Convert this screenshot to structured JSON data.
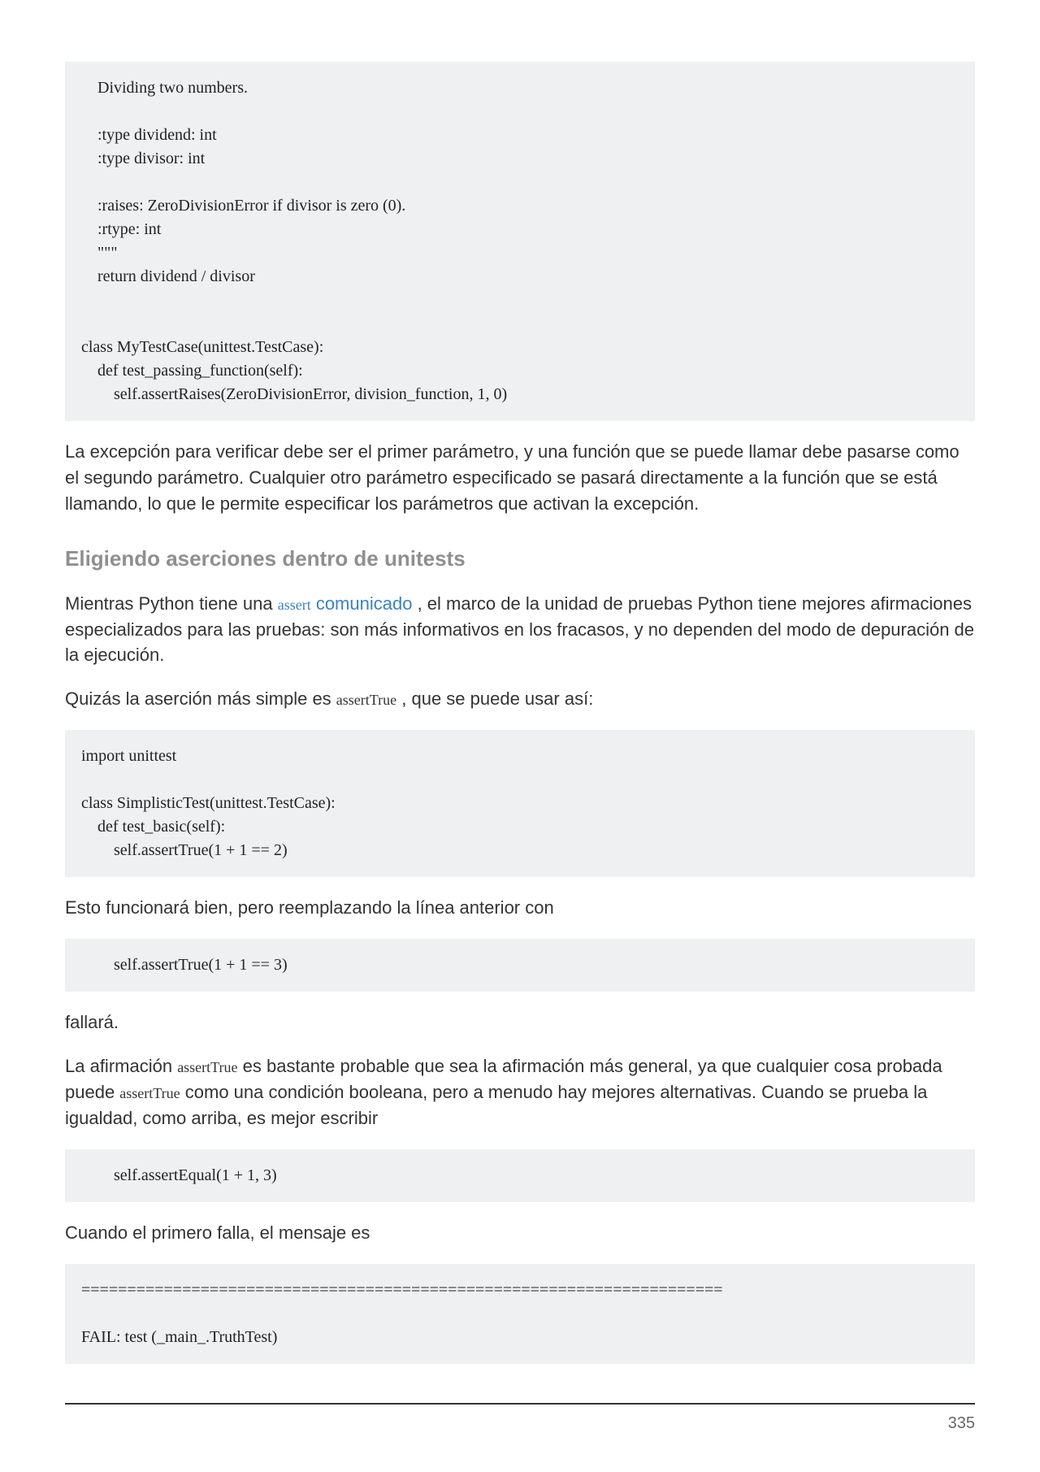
{
  "code1": "    Dividing two numbers.\n\n    :type dividend: int\n    :type divisor: int\n\n    :raises: ZeroDivisionError if divisor is zero (0).\n    :rtype: int\n    \"\"\"\n    return dividend / divisor\n\n\nclass MyTestCase(unittest.TestCase):\n    def test_passing_function(self):\n        self.assertRaises(ZeroDivisionError, division_function, 1, 0)",
  "para1": "La excepción para verificar debe ser el primer parámetro, y una función que se puede llamar debe pasarse como el segundo parámetro. Cualquier otro parámetro especificado se pasará directamente a la función que se está llamando, lo que le permite especificar los parámetros que activan la excepción.",
  "heading1": "Eligiendo aserciones dentro de unitests",
  "para2_pre": "Mientras Python tiene una ",
  "para2_link_small": "assert",
  "para2_link_big": " comunicado",
  "para2_post": " , el marco de la unidad de pruebas Python tiene mejores afirmaciones especializados para las pruebas: son más informativos en los fracasos, y no dependen del modo de depuración de la ejecución.",
  "para3_pre": "Quizás la aserción más simple es ",
  "para3_code": "assertTrue",
  "para3_post": " , que se puede usar así:",
  "code2": "import unittest\n\nclass SimplisticTest(unittest.TestCase):\n    def test_basic(self):\n        self.assertTrue(1 + 1 == 2)",
  "para4": "Esto funcionará bien, pero reemplazando la línea anterior con",
  "code3": "        self.assertTrue(1 + 1 == 3)",
  "para5": "fallará.",
  "para6_a": "La afirmación ",
  "para6_code1": "assertTrue",
  "para6_b": " es bastante probable que sea la afirmación más general, ya que cualquier cosa probada puede ",
  "para6_code2": "assertTrue",
  "para6_c": " como una condición booleana, pero a menudo hay mejores alternativas. Cuando se prueba la igualdad, como arriba, es mejor escribir",
  "code4": "        self.assertEqual(1 + 1, 3)",
  "para7": "Cuando el primero falla, el mensaje es",
  "code5": "======================================================================\n\nFAIL: test (_main_.TruthTest)",
  "pageNumber": "335"
}
